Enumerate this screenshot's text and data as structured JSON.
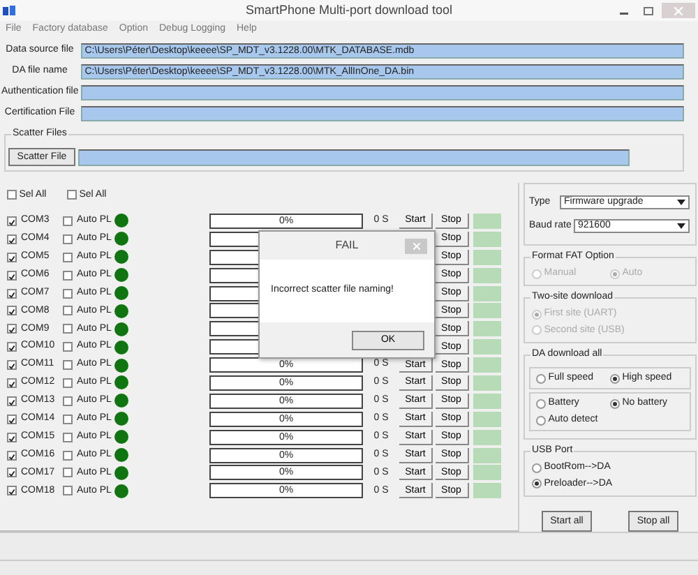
{
  "window": {
    "title": "SmartPhone Multi-port download tool"
  },
  "menu": [
    "File",
    "Factory database",
    "Option",
    "Debug Logging",
    "Help"
  ],
  "files": [
    {
      "label": "Data source file",
      "value": "C:\\Users\\Péter\\Desktop\\keeee\\SP_MDT_v3.1228.00\\MTK_DATABASE.mdb"
    },
    {
      "label": "DA file name",
      "value": "C:\\Users\\Péter\\Desktop\\keeee\\SP_MDT_v3.1228.00\\MTK_AllInOne_DA.bin"
    },
    {
      "label": "Authentication file"
    },
    {
      "label": "Certification File"
    }
  ],
  "scatter": {
    "group_label": "Scatter Files",
    "button": "Scatter File"
  },
  "select_all": [
    {
      "label": "Sel All",
      "checked": false
    },
    {
      "label": "Sel All",
      "checked": false
    }
  ],
  "ports": [
    {
      "name": "COM3",
      "checked": true,
      "auto_label": "Auto PL",
      "auto_checked": false,
      "level": 0,
      "progress": "0%",
      "time": "0 S",
      "start": "Start",
      "stop": "Stop"
    },
    {
      "name": "COM4",
      "checked": true,
      "auto_label": "Auto PL",
      "auto_checked": false,
      "level": 0,
      "stop": "Stop"
    },
    {
      "name": "COM5",
      "checked": true,
      "auto_label": "Auto PL",
      "auto_checked": false,
      "level": 0,
      "stop": "Stop"
    },
    {
      "name": "COM6",
      "checked": true,
      "auto_label": "Auto PL",
      "auto_checked": false,
      "level": 0,
      "stop": "Stop"
    },
    {
      "name": "COM7",
      "checked": true,
      "auto_label": "Auto PL",
      "auto_checked": false,
      "level": 0,
      "stop": "Stop"
    },
    {
      "name": "COM8",
      "checked": true,
      "auto_label": "Auto PL",
      "auto_checked": false,
      "level": 0,
      "stop": "Stop"
    },
    {
      "name": "COM9",
      "checked": true,
      "auto_label": "Auto PL",
      "auto_checked": false,
      "level": 0,
      "stop": "Stop"
    },
    {
      "name": "COM10",
      "checked": true,
      "auto_label": "Auto PL",
      "auto_checked": false,
      "level": 0,
      "stop": "Stop"
    },
    {
      "name": "COM11",
      "checked": true,
      "auto_label": "Auto PL",
      "auto_checked": false,
      "level": 0,
      "progress": "0%",
      "time": "0 S",
      "start": "Start",
      "stop": "Stop"
    },
    {
      "name": "COM12",
      "checked": true,
      "auto_label": "Auto PL",
      "auto_checked": false,
      "level": 0,
      "progress": "0%",
      "time": "0 S",
      "start": "Start",
      "stop": "Stop"
    },
    {
      "name": "COM13",
      "checked": true,
      "auto_label": "Auto PL",
      "auto_checked": false,
      "level": 0,
      "progress": "0%",
      "time": "0 S",
      "start": "Start",
      "stop": "Stop"
    },
    {
      "name": "COM14",
      "checked": true,
      "auto_label": "Auto PL",
      "auto_checked": false,
      "level": 0,
      "progress": "0%",
      "time": "0 S",
      "start": "Start",
      "stop": "Stop"
    },
    {
      "name": "COM15",
      "checked": true,
      "auto_label": "Auto PL",
      "auto_checked": false,
      "level": 0,
      "progress": "0%",
      "time": "0 S",
      "start": "Start",
      "stop": "Stop"
    },
    {
      "name": "COM16",
      "checked": true,
      "auto_label": "Auto PL",
      "auto_checked": false,
      "level": 0,
      "progress": "0%",
      "time": "0 S",
      "start": "Start",
      "stop": "Stop"
    },
    {
      "name": "COM17",
      "checked": true,
      "auto_label": "Auto PL",
      "auto_checked": false,
      "level": 0,
      "progress": "0%",
      "time": "0 S",
      "start": "Start",
      "stop": "Stop"
    },
    {
      "name": "COM18",
      "checked": true,
      "auto_label": "Auto PL",
      "auto_checked": false,
      "level": 0,
      "progress": "0%",
      "time": "0 S",
      "start": "Start",
      "stop": "Stop"
    }
  ],
  "settings": [
    {
      "label": "Type",
      "value": "Firmware upgrade"
    },
    {
      "label": "Baud rate",
      "value": "921600"
    }
  ],
  "groups": [
    {
      "title": "Format FAT Option",
      "sections": [
        {
          "kind": "grid",
          "options": [
            {
              "label": "Manual",
              "selected": false,
              "disabled": true
            },
            {
              "label": "Auto",
              "selected": true,
              "disabled": true
            }
          ]
        }
      ]
    },
    {
      "title": "Two-site download",
      "sections": [
        {
          "kind": "list",
          "options": [
            {
              "label": "First site (UART)",
              "selected": true,
              "disabled": true
            },
            {
              "label": "Second site (USB)",
              "selected": false,
              "disabled": true
            }
          ]
        }
      ]
    },
    {
      "title": "DA download all",
      "boxed": true,
      "sections": [
        {
          "kind": "grid",
          "options": [
            {
              "label": "Full speed",
              "selected": false,
              "disabled": false
            },
            {
              "label": "High speed",
              "selected": true,
              "disabled": false
            }
          ]
        },
        {
          "kind": "grid",
          "options": [
            {
              "label": "Battery",
              "selected": false,
              "disabled": false
            },
            {
              "label": "No battery",
              "selected": true,
              "disabled": false
            },
            {
              "label": "Auto detect",
              "selected": false,
              "disabled": false
            }
          ]
        }
      ]
    },
    {
      "title": "USB Port",
      "sections": [
        {
          "kind": "list",
          "options": [
            {
              "label": "BootRom-->DA",
              "selected": false,
              "disabled": false
            },
            {
              "label": "Preloader-->DA",
              "selected": true,
              "disabled": false
            }
          ]
        }
      ]
    }
  ],
  "buttons": [
    "Start all",
    "Stop all"
  ],
  "dialog": {
    "title": "FAIL",
    "message": "Incorrect scatter file naming!",
    "button": "OK"
  }
}
